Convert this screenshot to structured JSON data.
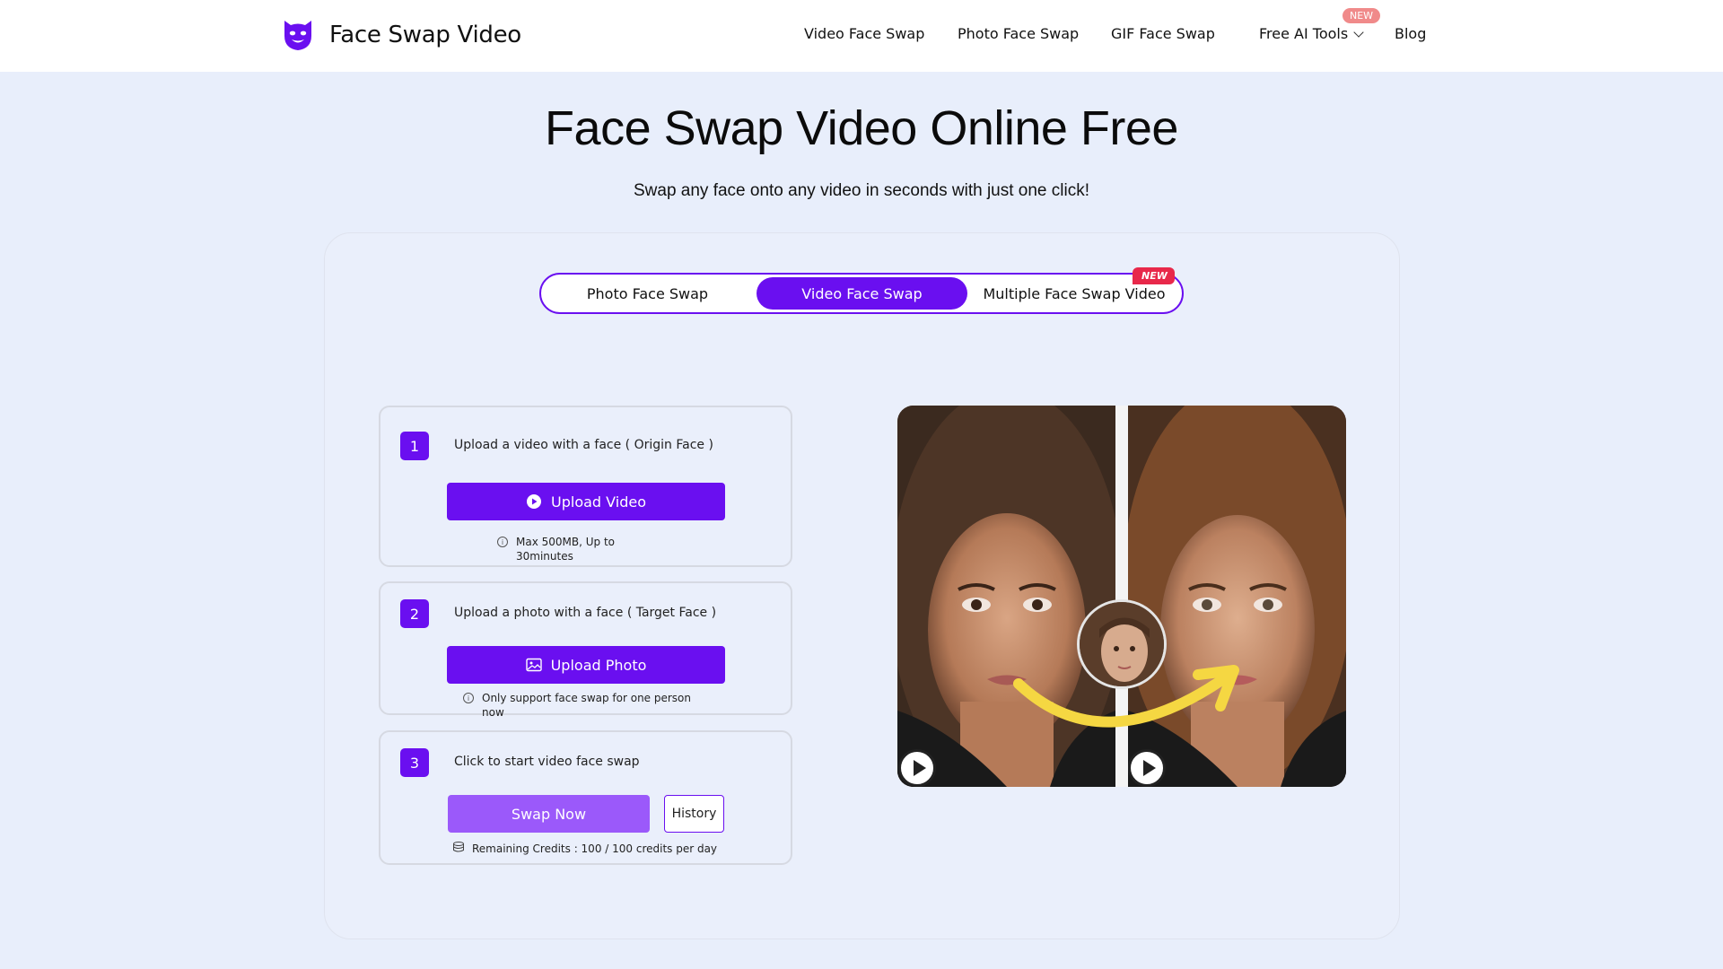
{
  "header": {
    "brand": "Face Swap Video",
    "nav": {
      "video_face_swap": "Video Face Swap",
      "photo_face_swap": "Photo Face Swap",
      "gif_face_swap": "GIF Face Swap",
      "free_ai_tools": "Free AI Tools",
      "free_ai_tools_badge": "NEW",
      "blog": "Blog"
    }
  },
  "hero": {
    "title": "Face Swap Video Online Free",
    "subtitle": "Swap any face onto any video in seconds with just one click!"
  },
  "modes": {
    "photo": "Photo Face Swap",
    "video": "Video Face Swap",
    "multiple": "Multiple Face Swap Video",
    "multiple_badge": "NEW",
    "active": "video"
  },
  "steps": {
    "step1": {
      "number": "1",
      "text": "Upload a video with a face ( Origin Face )",
      "button": "Upload Video",
      "note": "Max 500MB, Up to 30minutes"
    },
    "step2": {
      "number": "2",
      "text": "Upload a photo with a face ( Target Face )",
      "button": "Upload Photo",
      "note": "Only support face swap for one person now"
    },
    "step3": {
      "number": "3",
      "text": "Click to start video face swap",
      "button": "Swap Now",
      "history": "History",
      "credits": "Remaining Credits : 100 / 100 credits per day"
    }
  },
  "colors": {
    "accent": "#6a0ff0",
    "accent_light": "#9b59fa",
    "badge_red": "#e8284a",
    "badge_pink": "#f08a8a",
    "background": "#e8eefb"
  },
  "icons": {
    "logo": "mask-icon",
    "upload_video": "play-circle-icon",
    "upload_photo": "image-icon",
    "info": "info-icon",
    "credits": "coins-icon",
    "dropdown": "chevron-down-icon",
    "preview_play": "play-icon",
    "arrow": "swap-arrow"
  }
}
